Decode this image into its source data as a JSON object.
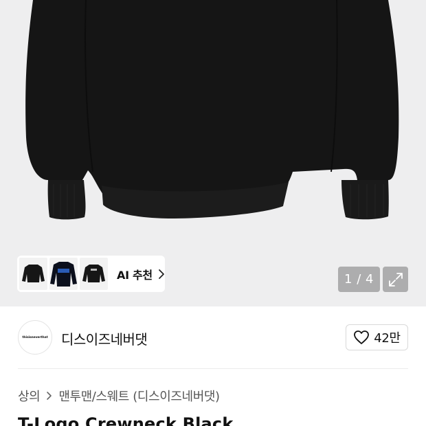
{
  "hero": {
    "image": "black-crewneck-sweatshirt",
    "pager": "1 / 4",
    "expand_icon": "expand-icon"
  },
  "ai_recommend": {
    "label": "AI 추천",
    "thumbnails": [
      "black-sweatshirt-thumb",
      "navy-logo-sweatshirt-thumb",
      "black-print-sweatshirt-thumb"
    ]
  },
  "brand": {
    "logo_text": "thisisneverthat",
    "name": "디스이즈네버댓",
    "like_count": "42만"
  },
  "breadcrumb": {
    "category": "상의",
    "subcategory": "맨투맨/스웨트 (디스이즈네버댓)"
  },
  "product": {
    "title": "T-Logo Crewneck Black"
  }
}
